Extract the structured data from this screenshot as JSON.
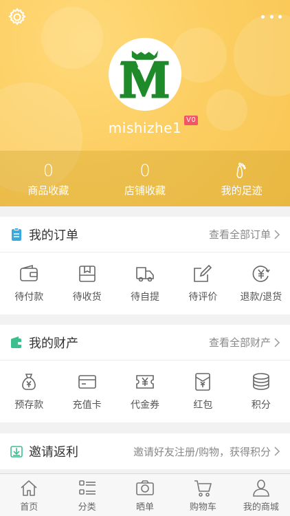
{
  "profile": {
    "username": "mishizhe1",
    "vip_badge": "V0",
    "avatar_letter": "M"
  },
  "stats": [
    {
      "value": "0",
      "label": "商品收藏"
    },
    {
      "value": "0",
      "label": "店铺收藏"
    },
    {
      "value": "",
      "label": "我的足迹"
    }
  ],
  "orders": {
    "title": "我的订单",
    "more": "查看全部订单",
    "items": [
      "待付款",
      "待收货",
      "待自提",
      "待评价",
      "退款/退货"
    ]
  },
  "assets": {
    "title": "我的财产",
    "more": "查看全部财产",
    "items": [
      "预存款",
      "充值卡",
      "代金券",
      "红包",
      "积分"
    ]
  },
  "invite": {
    "title": "邀请返利",
    "desc": "邀请好友注册/购物，获得积分"
  },
  "tabbar": [
    "首页",
    "分类",
    "晒单",
    "购物车",
    "我的商城"
  ],
  "colors": {
    "header": "#fccf63",
    "accent_blue": "#3aa9e0",
    "accent_green": "#3bbf8f",
    "badge": "#f25563"
  }
}
